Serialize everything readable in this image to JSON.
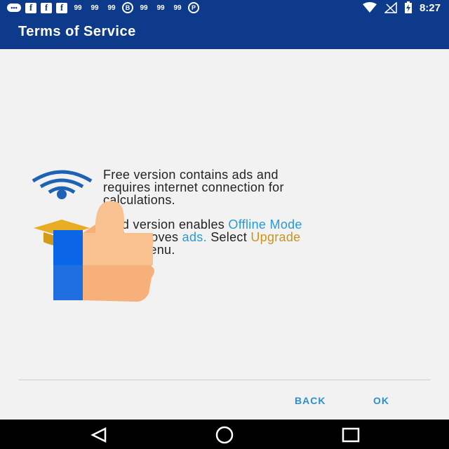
{
  "status_bar": {
    "time": "8:27",
    "notification_icons": [
      "message-icon",
      "facebook-icon",
      "facebook-icon",
      "facebook-icon",
      "chat-bubble-icon",
      "chat-bubble-icon",
      "chat-bubble-icon",
      "b-circle-icon",
      "chat-bubble-icon",
      "chat-bubble-icon",
      "chat-bubble-icon",
      "pinterest-icon"
    ],
    "system_icons": [
      "wifi-icon",
      "no-signal-icon",
      "battery-charging-icon"
    ]
  },
  "app_bar": {
    "title": "Terms of Service",
    "color": "#0d3a8a"
  },
  "content": {
    "free_line1": "Free version contains ads and",
    "free_line2": "requires internet connection for",
    "free_line3": "calculations.",
    "paid_line1_prefix": "Paid version enables ",
    "paid_offline_mode": "Offline Mode",
    "paid_line2_prefix": "and removes ",
    "paid_ads": "ads.",
    "paid_line2_mid": " Select ",
    "paid_upgrade": "Upgrade",
    "paid_line3": "in the menu.",
    "highlight_blue": "#2a9ad6",
    "highlight_gold": "#c9951d"
  },
  "dialog_buttons": {
    "back": "BACK",
    "ok": "OK"
  },
  "nav_bar": {
    "icons": [
      "back-triangle-icon",
      "home-circle-icon",
      "recents-square-icon"
    ]
  }
}
